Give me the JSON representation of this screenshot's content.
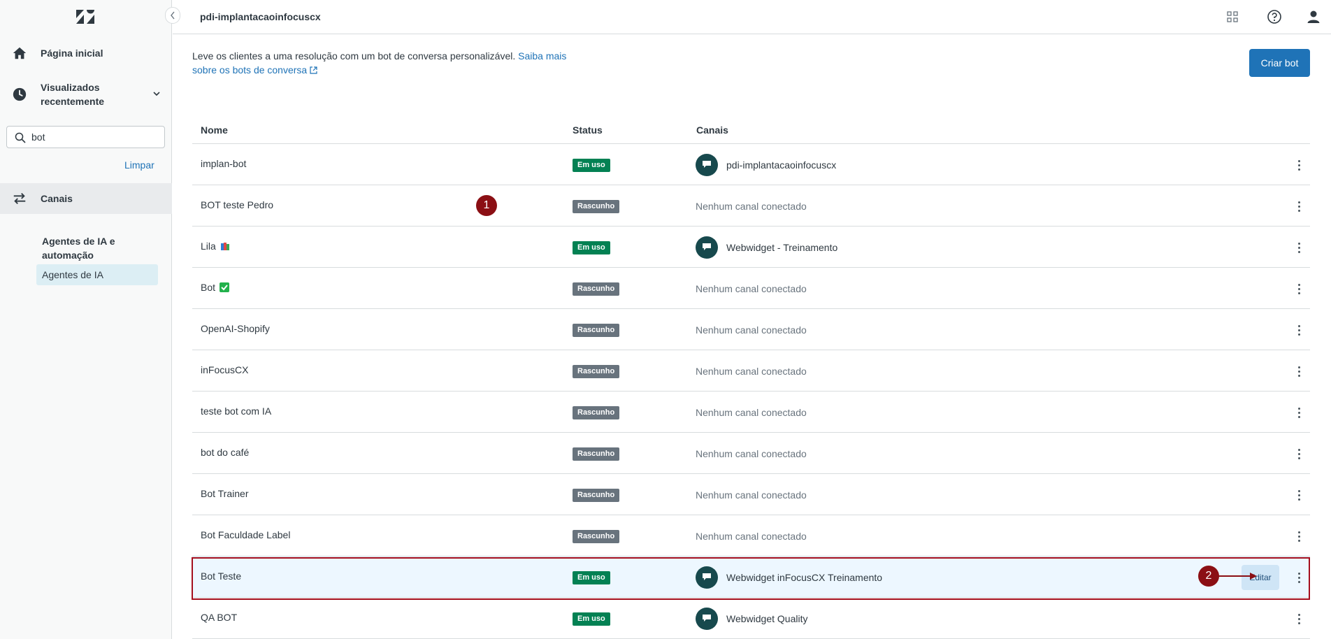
{
  "sidebar": {
    "home_label": "Página inicial",
    "recent_label_line1": "Visualizados",
    "recent_label_line2": "recentemente",
    "search_value": "bot",
    "clear_label": "Limpar",
    "channels_label": "Canais",
    "section_title": "Agentes de IA e automação",
    "section_item": "Agentes de IA"
  },
  "header": {
    "title": "pdi-implantacaoinfocuscx"
  },
  "main": {
    "intro_text": "Leve os clientes a uma resolução com um bot de conversa personalizável.",
    "intro_link": "Saiba mais sobre os bots de conversa",
    "create_button": "Criar bot",
    "columns": {
      "name": "Nome",
      "status": "Status",
      "channels": "Canais"
    },
    "edit_label": "Editar",
    "rows": [
      {
        "name": "implan-bot",
        "status": "Em uso",
        "channel": "pdi-implantacaoinfocuscx"
      },
      {
        "name": "BOT teste Pedro",
        "status": "Rascunho",
        "channel": "Nenhum canal conectado"
      },
      {
        "name": "Lila",
        "status": "Em uso",
        "channel": "Webwidget - Treinamento"
      },
      {
        "name": "Bot",
        "status": "Rascunho",
        "channel": "Nenhum canal conectado"
      },
      {
        "name": "OpenAI-Shopify",
        "status": "Rascunho",
        "channel": "Nenhum canal conectado"
      },
      {
        "name": "inFocusCX",
        "status": "Rascunho",
        "channel": "Nenhum canal conectado"
      },
      {
        "name": "teste bot com IA",
        "status": "Rascunho",
        "channel": "Nenhum canal conectado"
      },
      {
        "name": "bot do café",
        "status": "Rascunho",
        "channel": "Nenhum canal conectado"
      },
      {
        "name": "Bot Trainer",
        "status": "Rascunho",
        "channel": "Nenhum canal conectado"
      },
      {
        "name": "Bot Faculdade Label",
        "status": "Rascunho",
        "channel": "Nenhum canal conectado"
      },
      {
        "name": "Bot Teste",
        "status": "Em uso",
        "channel": "Webwidget inFocusCX Treinamento"
      },
      {
        "name": "QA BOT",
        "status": "Em uso",
        "channel": "Webwidget Quality"
      }
    ]
  },
  "annotations": {
    "marker_1": "1",
    "marker_2": "2"
  },
  "colors": {
    "primary": "#1f73b7",
    "in_use": "#038153",
    "draft": "#68737d",
    "highlight_border": "#a40e1d",
    "marker": "#8b0f14"
  }
}
